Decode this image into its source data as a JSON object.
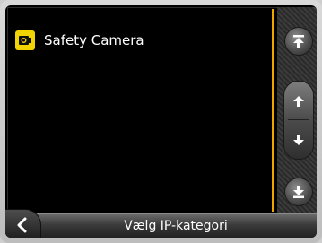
{
  "list": {
    "items": [
      {
        "label": "Safety Camera",
        "icon": "safety-camera-icon",
        "icon_color": "#f2d500"
      }
    ]
  },
  "scrollbar": {
    "buttons": [
      "scroll-to-top-icon",
      "scroll-up-icon",
      "scroll-down-icon",
      "scroll-to-bottom-icon"
    ]
  },
  "bottom_bar": {
    "title": "Vælg IP-kategori",
    "back_icon": "back-chevron-icon"
  },
  "colors": {
    "accent": "#f0a400",
    "background": "#000000",
    "text": "#ffffff"
  }
}
